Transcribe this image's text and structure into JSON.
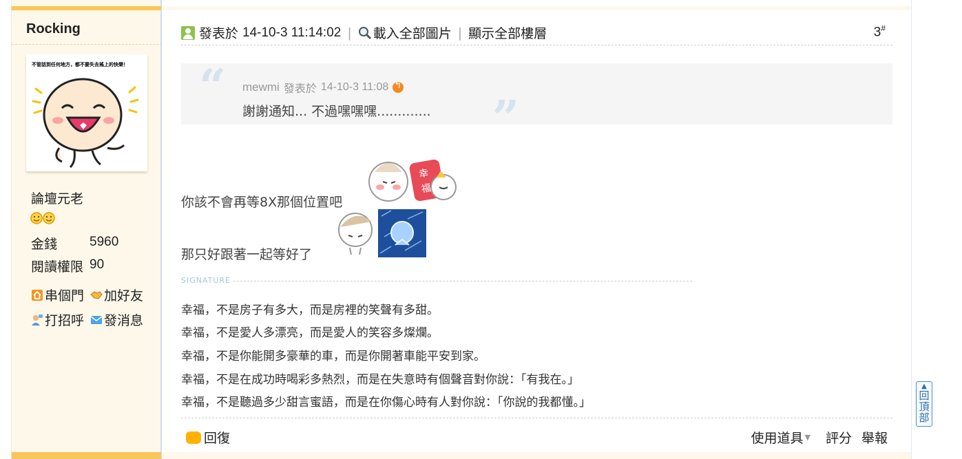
{
  "user": {
    "name": "Rocking",
    "avatar_caption": "不管話到任何地方，都不要失去搖上的快樂！",
    "rank": "論壇元老",
    "stats": [
      {
        "label": "金錢",
        "value": "5960"
      },
      {
        "label": "閱讀權限",
        "value": "90"
      }
    ],
    "links": [
      {
        "label": "串個門"
      },
      {
        "label": "加好友"
      },
      {
        "label": "打招呼"
      },
      {
        "label": "發消息"
      }
    ]
  },
  "post": {
    "posted_label": "發表於",
    "timestamp": "14-10-3 11:14:02",
    "load_images": "載入全部圖片",
    "show_all_floors": "顯示全部樓層",
    "floor_number": "3",
    "floor_mark": "#",
    "quote": {
      "author": "mewmi",
      "posted_label": "發表於",
      "timestamp": "14-10-3 11:08",
      "text": "謝謝通知... 不過嘿嘿嘿............."
    },
    "lines": [
      "你該不會再等8X那個位置吧",
      "那只好跟著一起等好了"
    ],
    "emoticon_text": "幸福",
    "signature_label": "SIGNATURE",
    "signature": [
      "幸福，不是房子有多大，而是房裡的笑聲有多甜。",
      "幸福，不是愛人多漂亮，而是愛人的笑容多燦爛。",
      "幸福，不是你能開多豪華的車，而是你開著車能平安到家。",
      "幸福，不是在成功時喝彩多熱烈，而是在失意時有個聲音對你說：「有我在。」",
      "幸福，不是聽過多少甜言蜜語，而是在你傷心時有人對你說：「你說的我都懂。」"
    ],
    "reply_label": "回復",
    "use_tool_label": "使用道具",
    "rate_label": "評分",
    "report_label": "舉報"
  },
  "back_to_top": "回頂部",
  "colors": {
    "accent_bar": "#fbc559",
    "sidebar_bg": "#fdf8ea",
    "quote_bg": "#f5f5f5"
  }
}
